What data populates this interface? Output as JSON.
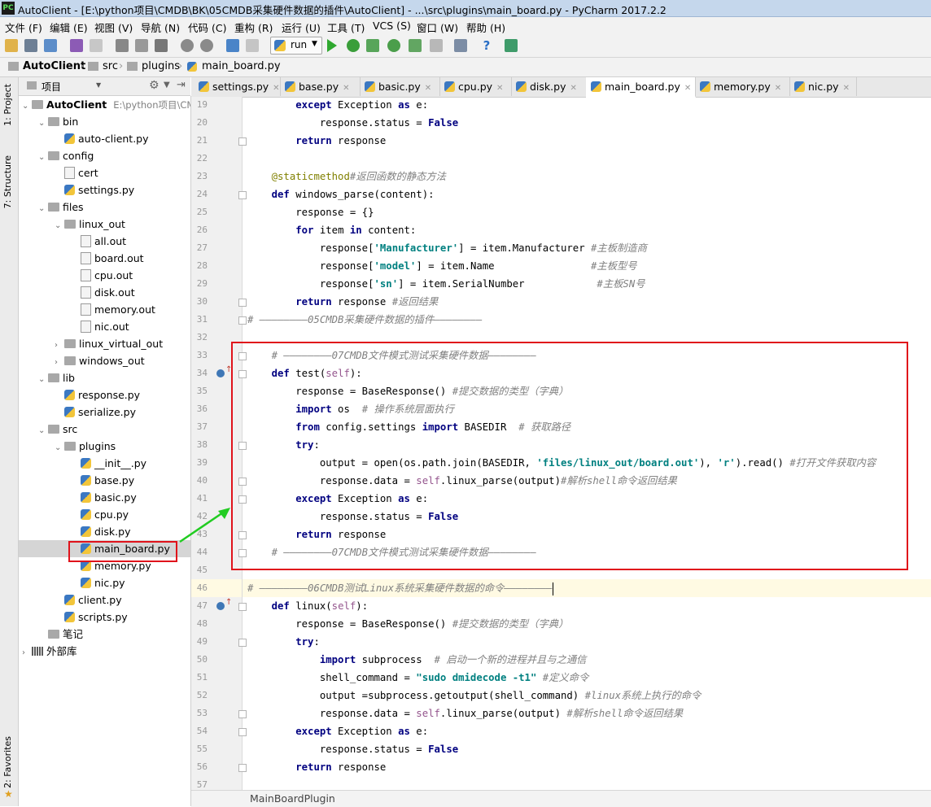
{
  "window": {
    "title": "AutoClient - [E:\\python项目\\CMDB\\BK\\05CMDB采集硬件数据的插件\\AutoClient] - ...\\src\\plugins\\main_board.py - PyCharm 2017.2.2",
    "app_icon": "PC"
  },
  "menu": [
    "文件 (F)",
    "编辑 (E)",
    "视图 (V)",
    "导航 (N)",
    "代码 (C)",
    "重构 (R)",
    "运行 (U)",
    "工具 (T)",
    "VCS (S)",
    "窗口 (W)",
    "帮助 (H)"
  ],
  "toolbar": {
    "run_config": "run"
  },
  "nav": [
    "AutoClient",
    "src",
    "plugins",
    "main_board.py"
  ],
  "side_tabs": [
    "1: Project",
    "7: Structure",
    "2: Favorites"
  ],
  "project_panel": {
    "title": "项目"
  },
  "tree": [
    {
      "label": "AutoClient",
      "extra": "E:\\python项目\\CM",
      "indent": 0,
      "arrow": "▼",
      "icon": "folder",
      "bold": true
    },
    {
      "label": "bin",
      "indent": 1,
      "arrow": "▼",
      "icon": "folder"
    },
    {
      "label": "auto-client.py",
      "indent": 2,
      "arrow": "",
      "icon": "py"
    },
    {
      "label": "config",
      "indent": 1,
      "arrow": "▼",
      "icon": "folder"
    },
    {
      "label": "cert",
      "indent": 2,
      "arrow": "",
      "icon": "file"
    },
    {
      "label": "settings.py",
      "indent": 2,
      "arrow": "",
      "icon": "py"
    },
    {
      "label": "files",
      "indent": 1,
      "arrow": "▼",
      "icon": "folder"
    },
    {
      "label": "linux_out",
      "indent": 2,
      "arrow": "▼",
      "icon": "folder"
    },
    {
      "label": "all.out",
      "indent": 3,
      "arrow": "",
      "icon": "file"
    },
    {
      "label": "board.out",
      "indent": 3,
      "arrow": "",
      "icon": "file"
    },
    {
      "label": "cpu.out",
      "indent": 3,
      "arrow": "",
      "icon": "file"
    },
    {
      "label": "disk.out",
      "indent": 3,
      "arrow": "",
      "icon": "file"
    },
    {
      "label": "memory.out",
      "indent": 3,
      "arrow": "",
      "icon": "file"
    },
    {
      "label": "nic.out",
      "indent": 3,
      "arrow": "",
      "icon": "file"
    },
    {
      "label": "linux_virtual_out",
      "indent": 2,
      "arrow": "▶",
      "icon": "folder"
    },
    {
      "label": "windows_out",
      "indent": 2,
      "arrow": "▶",
      "icon": "folder"
    },
    {
      "label": "lib",
      "indent": 1,
      "arrow": "▼",
      "icon": "folder"
    },
    {
      "label": "response.py",
      "indent": 2,
      "arrow": "",
      "icon": "py"
    },
    {
      "label": "serialize.py",
      "indent": 2,
      "arrow": "",
      "icon": "py"
    },
    {
      "label": "src",
      "indent": 1,
      "arrow": "▼",
      "icon": "folder"
    },
    {
      "label": "plugins",
      "indent": 2,
      "arrow": "▼",
      "icon": "folder"
    },
    {
      "label": "__init__.py",
      "indent": 3,
      "arrow": "",
      "icon": "py"
    },
    {
      "label": "base.py",
      "indent": 3,
      "arrow": "",
      "icon": "py"
    },
    {
      "label": "basic.py",
      "indent": 3,
      "arrow": "",
      "icon": "py"
    },
    {
      "label": "cpu.py",
      "indent": 3,
      "arrow": "",
      "icon": "py"
    },
    {
      "label": "disk.py",
      "indent": 3,
      "arrow": "",
      "icon": "py"
    },
    {
      "label": "main_board.py",
      "indent": 3,
      "arrow": "",
      "icon": "py",
      "selected": true
    },
    {
      "label": "memory.py",
      "indent": 3,
      "arrow": "",
      "icon": "py"
    },
    {
      "label": "nic.py",
      "indent": 3,
      "arrow": "",
      "icon": "py"
    },
    {
      "label": "client.py",
      "indent": 2,
      "arrow": "",
      "icon": "py"
    },
    {
      "label": "scripts.py",
      "indent": 2,
      "arrow": "",
      "icon": "py"
    },
    {
      "label": "笔记",
      "indent": 1,
      "arrow": "",
      "icon": "folder"
    },
    {
      "label": "外部库",
      "indent": 0,
      "arrow": "▶",
      "icon": "lib"
    }
  ],
  "tabs": [
    {
      "label": "settings.py"
    },
    {
      "label": "base.py"
    },
    {
      "label": "basic.py"
    },
    {
      "label": "cpu.py"
    },
    {
      "label": "disk.py"
    },
    {
      "label": "main_board.py",
      "active": true
    },
    {
      "label": "memory.py"
    },
    {
      "label": "nic.py"
    }
  ],
  "code": [
    {
      "n": "19",
      "t": [
        [
          "        "
        ],
        [
          "except",
          "kw"
        ],
        [
          " Exception "
        ],
        [
          "as",
          "kw"
        ],
        [
          " e:"
        ]
      ]
    },
    {
      "n": "20",
      "t": [
        [
          "            response.status = "
        ],
        [
          "False",
          "kw"
        ]
      ]
    },
    {
      "n": "21",
      "t": [
        [
          "        "
        ],
        [
          "return",
          "kw"
        ],
        [
          " response"
        ]
      ]
    },
    {
      "n": "22",
      "t": [
        [
          ""
        ]
      ]
    },
    {
      "n": "23",
      "t": [
        [
          "    "
        ],
        [
          "@staticmethod",
          "deco"
        ],
        [
          "#返回函数的静态方法",
          "cm"
        ]
      ]
    },
    {
      "n": "24",
      "t": [
        [
          "    "
        ],
        [
          "def",
          "kw"
        ],
        [
          " windows_parse(content):"
        ]
      ]
    },
    {
      "n": "25",
      "t": [
        [
          "        response = {}"
        ]
      ]
    },
    {
      "n": "26",
      "t": [
        [
          "        "
        ],
        [
          "for",
          "kw"
        ],
        [
          " item "
        ],
        [
          "in",
          "kw"
        ],
        [
          " content:"
        ]
      ]
    },
    {
      "n": "27",
      "t": [
        [
          "            response["
        ],
        [
          "'Manufacturer'",
          "str"
        ],
        [
          "] = item.Manufacturer "
        ],
        [
          "#主板制造商",
          "cm"
        ]
      ]
    },
    {
      "n": "28",
      "t": [
        [
          "            response["
        ],
        [
          "'model'",
          "str"
        ],
        [
          "] = item.Name                "
        ],
        [
          "#主板型号",
          "cm"
        ]
      ]
    },
    {
      "n": "29",
      "t": [
        [
          "            response["
        ],
        [
          "'sn'",
          "str"
        ],
        [
          "] = item.SerialNumber            "
        ],
        [
          "#主板SN号",
          "cm"
        ]
      ]
    },
    {
      "n": "30",
      "t": [
        [
          "        "
        ],
        [
          "return",
          "kw"
        ],
        [
          " response "
        ],
        [
          "#返回结果",
          "cm"
        ]
      ]
    },
    {
      "n": "31",
      "t": [
        [
          "# ————————05CMDB采集硬件数据的插件————————",
          "cm"
        ]
      ]
    },
    {
      "n": "32",
      "t": [
        [
          ""
        ]
      ]
    },
    {
      "n": "33",
      "t": [
        [
          "    "
        ],
        [
          "# ————————07CMDB文件模式测试采集硬件数据————————",
          "cm"
        ]
      ]
    },
    {
      "n": "34",
      "t": [
        [
          "    "
        ],
        [
          "def",
          "kw"
        ],
        [
          " test("
        ],
        [
          "self",
          "slf"
        ],
        [
          "):"
        ]
      ]
    },
    {
      "n": "35",
      "t": [
        [
          "        response = BaseResponse() "
        ],
        [
          "#提交数据的类型（字典）",
          "cm"
        ]
      ]
    },
    {
      "n": "36",
      "t": [
        [
          "        "
        ],
        [
          "import",
          "kw"
        ],
        [
          " os  "
        ],
        [
          "# 操作系统层面执行",
          "cm"
        ]
      ]
    },
    {
      "n": "37",
      "t": [
        [
          "        "
        ],
        [
          "from",
          "kw"
        ],
        [
          " config.settings "
        ],
        [
          "import",
          "kw"
        ],
        [
          " BASEDIR  "
        ],
        [
          "# 获取路径",
          "cm"
        ]
      ]
    },
    {
      "n": "38",
      "t": [
        [
          "        "
        ],
        [
          "try",
          "kw"
        ],
        [
          ":"
        ]
      ]
    },
    {
      "n": "39",
      "t": [
        [
          "            output = open(os.path.join(BASEDIR, "
        ],
        [
          "'files/linux_out/board.out'",
          "str"
        ],
        [
          "), "
        ],
        [
          "'r'",
          "str"
        ],
        [
          ").read() "
        ],
        [
          "#打开文件获取内容",
          "cm"
        ]
      ]
    },
    {
      "n": "40",
      "t": [
        [
          "            response.data = "
        ],
        [
          "self",
          "slf"
        ],
        [
          ".linux_parse(output)"
        ],
        [
          "#解析shell命令返回结果",
          "cm"
        ]
      ]
    },
    {
      "n": "41",
      "t": [
        [
          "        "
        ],
        [
          "except",
          "kw"
        ],
        [
          " Exception "
        ],
        [
          "as",
          "kw"
        ],
        [
          " e:"
        ]
      ]
    },
    {
      "n": "42",
      "t": [
        [
          "            response.status = "
        ],
        [
          "False",
          "kw"
        ]
      ]
    },
    {
      "n": "43",
      "t": [
        [
          "        "
        ],
        [
          "return",
          "kw"
        ],
        [
          " response"
        ]
      ]
    },
    {
      "n": "44",
      "t": [
        [
          "    "
        ],
        [
          "# ————————07CMDB文件模式测试采集硬件数据————————",
          "cm"
        ]
      ]
    },
    {
      "n": "45",
      "t": [
        [
          ""
        ]
      ]
    },
    {
      "n": "46",
      "t": [
        [
          "# ————————06CMDB测试Linux系统采集硬件数据的命令————————",
          "cm"
        ]
      ]
    },
    {
      "n": "47",
      "t": [
        [
          "    "
        ],
        [
          "def",
          "kw"
        ],
        [
          " linux("
        ],
        [
          "self",
          "slf"
        ],
        [
          "):"
        ]
      ]
    },
    {
      "n": "48",
      "t": [
        [
          "        response = BaseResponse() "
        ],
        [
          "#提交数据的类型（字典）",
          "cm"
        ]
      ]
    },
    {
      "n": "49",
      "t": [
        [
          "        "
        ],
        [
          "try",
          "kw"
        ],
        [
          ":"
        ]
      ]
    },
    {
      "n": "50",
      "t": [
        [
          "            "
        ],
        [
          "import",
          "kw"
        ],
        [
          " subprocess  "
        ],
        [
          "# 启动一个新的进程并且与之通信",
          "cm"
        ]
      ]
    },
    {
      "n": "51",
      "t": [
        [
          "            shell_command = "
        ],
        [
          "\"sudo dmidecode -t1\"",
          "str"
        ],
        [
          " "
        ],
        [
          "#定义命令",
          "cm"
        ]
      ]
    },
    {
      "n": "52",
      "t": [
        [
          "            output =subprocess.getoutput(shell_command) "
        ],
        [
          "#linux系统上执行的命令",
          "cm"
        ]
      ]
    },
    {
      "n": "53",
      "t": [
        [
          "            response.data = "
        ],
        [
          "self",
          "slf"
        ],
        [
          ".linux_parse(output) "
        ],
        [
          "#解析shell命令返回结果",
          "cm"
        ]
      ]
    },
    {
      "n": "54",
      "t": [
        [
          "        "
        ],
        [
          "except",
          "kw"
        ],
        [
          " Exception "
        ],
        [
          "as",
          "kw"
        ],
        [
          " e:"
        ]
      ]
    },
    {
      "n": "55",
      "t": [
        [
          "            response.status = "
        ],
        [
          "False",
          "kw"
        ]
      ]
    },
    {
      "n": "56",
      "t": [
        [
          "        "
        ],
        [
          "return",
          "kw"
        ],
        [
          " response"
        ]
      ]
    },
    {
      "n": "57",
      "t": [
        [
          ""
        ]
      ]
    }
  ],
  "status": {
    "breadcrumb": "MainBoardPlugin"
  },
  "colors": {
    "annotation_box": "#e0131b",
    "arrow": "#22cc22",
    "current_line": "#fffae3"
  }
}
